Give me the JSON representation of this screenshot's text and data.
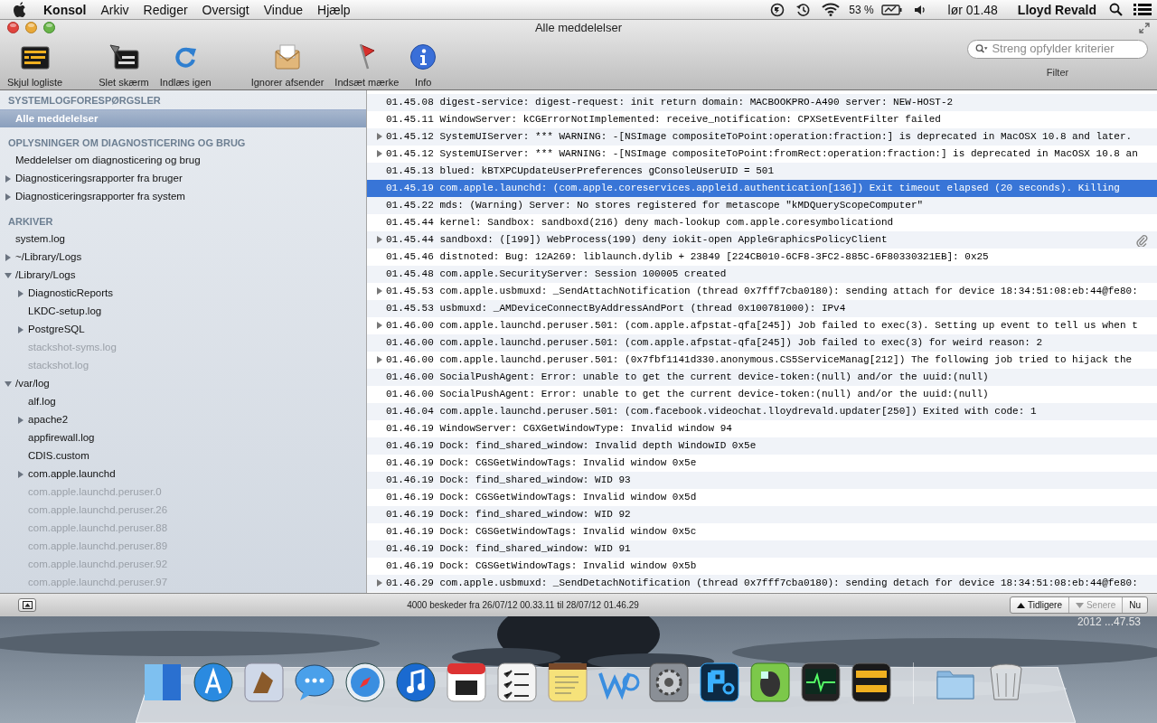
{
  "menubar": {
    "app": "Konsol",
    "menus": [
      "Arkiv",
      "Rediger",
      "Oversigt",
      "Vindue",
      "Hjælp"
    ],
    "battery": "53 %",
    "clock": "lør 01.48",
    "user": "Lloyd Revald"
  },
  "window": {
    "title": "Alle meddelelser"
  },
  "toolbar": {
    "groups": [
      [
        {
          "label": "Skjul logliste"
        }
      ],
      [
        {
          "label": "Slet skærm"
        },
        {
          "label": "Indlæs igen"
        }
      ],
      [
        {
          "label": "Ignorer afsender"
        },
        {
          "label": "Indsæt mærke"
        },
        {
          "label": "Info"
        }
      ]
    ],
    "search": {
      "placeholder": "Streng opfylder kriterier",
      "label": "Filter"
    }
  },
  "sidebar": {
    "sections": [
      {
        "title": "SYSTEMLOGFORESPØRGSLER",
        "items": [
          {
            "label": "Alle meddelelser",
            "selected": true,
            "dimmed": false
          }
        ]
      },
      {
        "title": "OPLYSNINGER OM DIAGNOSTICERING OG BRUG",
        "items": [
          {
            "label": "Meddelelser om diagnosticering og brug",
            "selected": false,
            "dimmed": false
          },
          {
            "label": "Diagnosticeringsrapporter fra bruger",
            "selected": false,
            "dimmed": false,
            "expanded": false
          },
          {
            "label": "Diagnosticeringsrapporter fra system",
            "selected": false,
            "dimmed": false,
            "expanded": false
          }
        ]
      },
      {
        "title": "ARKIVER",
        "items": [
          {
            "label": "system.log",
            "selected": false,
            "dimmed": false
          },
          {
            "label": "~/Library/Logs",
            "selected": false,
            "dimmed": false,
            "expanded": false
          },
          {
            "label": "/Library/Logs",
            "selected": false,
            "dimmed": false,
            "expanded": true,
            "children": [
              {
                "label": "DiagnosticReports",
                "selected": false,
                "dimmed": false,
                "expanded": false
              },
              {
                "label": "LKDC-setup.log",
                "selected": false,
                "dimmed": false
              },
              {
                "label": "PostgreSQL",
                "selected": false,
                "dimmed": false,
                "expanded": false
              },
              {
                "label": "stackshot-syms.log",
                "selected": false,
                "dimmed": true
              },
              {
                "label": "stackshot.log",
                "selected": false,
                "dimmed": true
              }
            ]
          },
          {
            "label": "/var/log",
            "selected": false,
            "dimmed": false,
            "expanded": true,
            "children": [
              {
                "label": "alf.log",
                "selected": false,
                "dimmed": false
              },
              {
                "label": "apache2",
                "selected": false,
                "dimmed": false,
                "expanded": false
              },
              {
                "label": "appfirewall.log",
                "selected": false,
                "dimmed": false
              },
              {
                "label": "CDIS.custom",
                "selected": false,
                "dimmed": false
              },
              {
                "label": "com.apple.launchd",
                "selected": false,
                "dimmed": false,
                "expanded": false
              },
              {
                "label": "com.apple.launchd.peruser.0",
                "selected": false,
                "dimmed": true
              },
              {
                "label": "com.apple.launchd.peruser.26",
                "selected": false,
                "dimmed": true
              },
              {
                "label": "com.apple.launchd.peruser.88",
                "selected": false,
                "dimmed": true
              },
              {
                "label": "com.apple.launchd.peruser.89",
                "selected": false,
                "dimmed": true
              },
              {
                "label": "com.apple.launchd.peruser.92",
                "selected": false,
                "dimmed": true
              },
              {
                "label": "com.apple.launchd.peruser.97",
                "selected": false,
                "dimmed": true
              }
            ]
          }
        ]
      }
    ]
  },
  "log": {
    "rows": [
      {
        "text": "01.45.08 digest-service: digest-request: init return domain: MACBOOKPRO-A490 server: NEW-HOST-2",
        "selected": false
      },
      {
        "text": "01.45.11 WindowServer: kCGErrorNotImplemented: receive_notification: CPXSetEventFilter failed",
        "selected": false
      },
      {
        "text": "01.45.12 SystemUIServer: *** WARNING: -[NSImage compositeToPoint:operation:fraction:] is deprecated in MacOSX 10.8 and later.",
        "selected": false,
        "expanded": false
      },
      {
        "text": "01.45.12 SystemUIServer: *** WARNING: -[NSImage compositeToPoint:fromRect:operation:fraction:] is deprecated in MacOSX 10.8 an",
        "selected": false,
        "expanded": false
      },
      {
        "text": "01.45.13 blued: kBTXPCUpdateUserPreferences gConsoleUserUID = 501",
        "selected": false
      },
      {
        "text": "01.45.19 com.apple.launchd: (com.apple.coreservices.appleid.authentication[136]) Exit timeout elapsed (20 seconds). Killing",
        "selected": true
      },
      {
        "text": "01.45.22 mds: (Warning) Server: No stores registered for metascope \"kMDQueryScopeComputer\"",
        "selected": false
      },
      {
        "text": "01.45.44 kernel: Sandbox: sandboxd(216) deny mach-lookup com.apple.coresymbolicationd",
        "selected": false
      },
      {
        "text": "01.45.44 sandboxd: ([199]) WebProcess(199) deny iokit-open AppleGraphicsPolicyClient",
        "selected": false,
        "expanded": false,
        "attachment": true
      },
      {
        "text": "01.45.46 distnoted: Bug: 12A269: liblaunch.dylib + 23849 [224CB010-6CF8-3FC2-885C-6F80330321EB]: 0x25",
        "selected": false
      },
      {
        "text": "01.45.48 com.apple.SecurityServer: Session 100005 created",
        "selected": false
      },
      {
        "text": "01.45.53 com.apple.usbmuxd: _SendAttachNotification (thread 0x7fff7cba0180): sending attach for device 18:34:51:08:eb:44@fe80:",
        "selected": false,
        "expanded": false
      },
      {
        "text": "01.45.53 usbmuxd: _AMDeviceConnectByAddressAndPort (thread 0x100781000): IPv4",
        "selected": false
      },
      {
        "text": "01.46.00 com.apple.launchd.peruser.501: (com.apple.afpstat-qfa[245]) Job failed to exec(3). Setting up event to tell us when t",
        "selected": false,
        "expanded": false
      },
      {
        "text": "01.46.00 com.apple.launchd.peruser.501: (com.apple.afpstat-qfa[245]) Job failed to exec(3) for weird reason: 2",
        "selected": false
      },
      {
        "text": "01.46.00 com.apple.launchd.peruser.501: (0x7fbf1141d330.anonymous.CS5ServiceManag[212]) The following job tried to hijack the",
        "selected": false,
        "expanded": false
      },
      {
        "text": "01.46.00 SocialPushAgent: Error: unable to get the current device-token:(null) and/or the uuid:(null)",
        "selected": false
      },
      {
        "text": "01.46.00 SocialPushAgent: Error: unable to get the current device-token:(null) and/or the uuid:(null)",
        "selected": false
      },
      {
        "text": "01.46.04 com.apple.launchd.peruser.501: (com.facebook.videochat.lloydrevald.updater[250]) Exited with code: 1",
        "selected": false
      },
      {
        "text": "01.46.19 WindowServer: CGXGetWindowType: Invalid window 94",
        "selected": false
      },
      {
        "text": "01.46.19 Dock: find_shared_window: Invalid depth WindowID 0x5e",
        "selected": false
      },
      {
        "text": "01.46.19 Dock: CGSGetWindowTags: Invalid window 0x5e",
        "selected": false
      },
      {
        "text": "01.46.19 Dock: find_shared_window: WID 93",
        "selected": false
      },
      {
        "text": "01.46.19 Dock: CGSGetWindowTags: Invalid window 0x5d",
        "selected": false
      },
      {
        "text": "01.46.19 Dock: find_shared_window: WID 92",
        "selected": false
      },
      {
        "text": "01.46.19 Dock: CGSGetWindowTags: Invalid window 0x5c",
        "selected": false
      },
      {
        "text": "01.46.19 Dock: find_shared_window: WID 91",
        "selected": false
      },
      {
        "text": "01.46.19 Dock: CGSGetWindowTags: Invalid window 0x5b",
        "selected": false
      },
      {
        "text": "01.46.29 com.apple.usbmuxd: _SendDetachNotification (thread 0x7fff7cba0180): sending detach for device 18:34:51:08:eb:44@fe80:",
        "selected": false,
        "expanded": false
      }
    ]
  },
  "status_bar": {
    "text": "4000 beskeder fra 26/07/12 00.33.11 til 28/07/12 01.46.29",
    "nav": [
      {
        "label": "Tidligere",
        "disabled": false
      },
      {
        "label": "Senere",
        "disabled": true
      },
      {
        "label": "Nu",
        "disabled": false
      }
    ]
  },
  "desktop": {
    "label": "2012 ...47.53"
  }
}
